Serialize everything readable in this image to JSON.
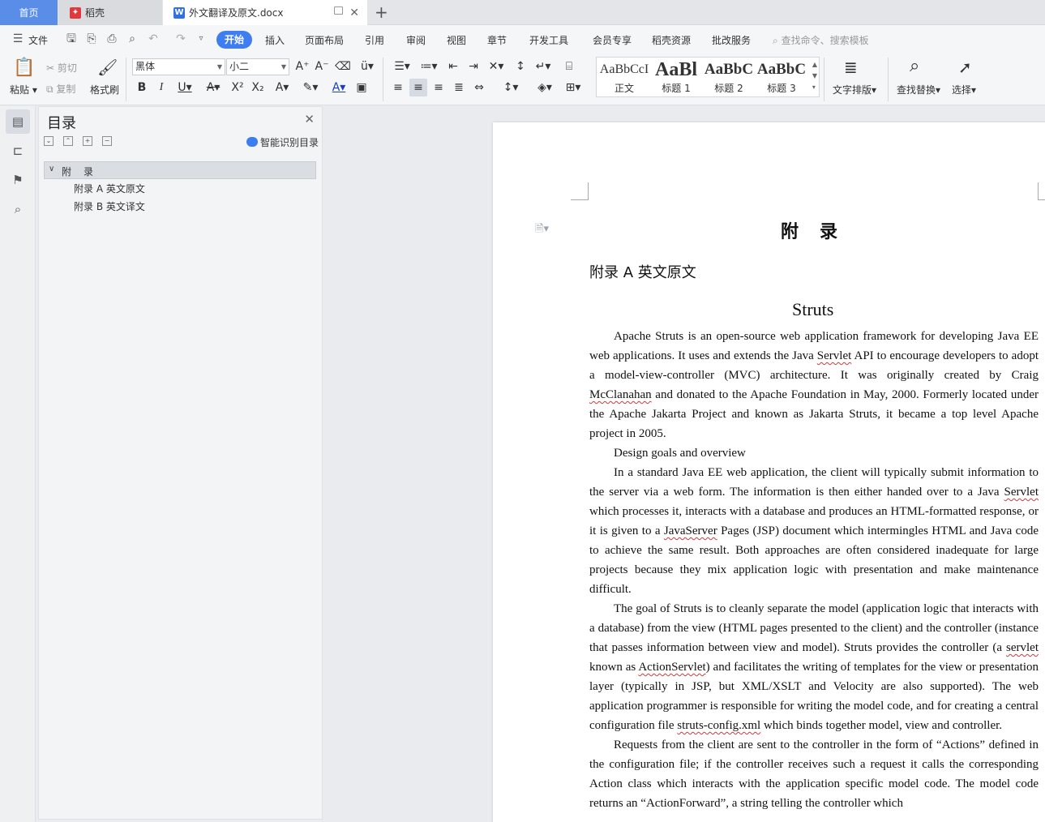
{
  "tabs": {
    "home": "首页",
    "daoke": "稻壳",
    "doc": "外文翻译及原文.docx",
    "new_tab_icon": "plus-icon"
  },
  "menu": {
    "file": "文件",
    "items": [
      "开始",
      "插入",
      "页面布局",
      "引用",
      "审阅",
      "视图",
      "章节",
      "开发工具",
      "会员专享",
      "稻壳资源",
      "批改服务"
    ],
    "search_placeholder": "查找命令、搜索模板"
  },
  "ribbon": {
    "paste": "粘贴",
    "cut": "剪切",
    "copy": "复制",
    "format_painter": "格式刷",
    "font_name": "黑体",
    "font_size": "小二",
    "styles": [
      {
        "preview": "AaBbCcI",
        "name": "正文"
      },
      {
        "preview": "AaBl",
        "name": "标题 1"
      },
      {
        "preview": "AaBbC",
        "name": "标题 2"
      },
      {
        "preview": "AaBbC",
        "name": "标题 3"
      }
    ],
    "text_layout": "文字排版",
    "find_replace": "查找替换",
    "select": "选择"
  },
  "nav": {
    "title": "目录",
    "smart_toc": "智能识别目录",
    "root": "附录",
    "items": [
      "附录 A  英文原文",
      "附录 B  英文译文"
    ]
  },
  "document": {
    "heading": "附录",
    "subheading": "附录 A  英文原文",
    "title": "Struts",
    "p1_a": "Apache Struts is an open-source web application framework for developing Java EE web applications. It uses and extends the Java ",
    "p1_w1": "Servlet",
    "p1_b": " API to encourage developers to adopt a model-view-controller (MVC) architecture. It was originally created by Craig ",
    "p1_w2": "McClanahan",
    "p1_c": " and donated to the Apache Foundation in May, 2000. Formerly located under the Apache Jakarta Project and known as Jakarta Struts, it became a top level Apache project in 2005.",
    "p2": "Design goals and overview",
    "p3_a": "In a standard Java EE web application, the client will typically submit information to the server via a web form. The information is then either handed over to a Java ",
    "p3_w1": "Servlet",
    "p3_b": " which processes it, interacts with a database and produces an HTML-formatted response, or it is given to a ",
    "p3_w2": "JavaServer",
    "p3_c": " Pages (JSP) document which intermingles HTML and Java code to achieve the same result. Both approaches are often considered inadequate for large projects because they mix application logic with presentation and make maintenance difficult.",
    "p4_a": "The goal of Struts is to cleanly separate the model (application logic that interacts with a database) from the view (HTML pages presented to the client) and the controller (instance that passes information between view and model). Struts provides the controller (a ",
    "p4_w1": "servlet",
    "p4_b": " known as ",
    "p4_w2": "ActionServlet",
    "p4_c": ") and facilitates the writing of templates for the view or presentation layer (typically in JSP, but XML/XSLT and Velocity are also supported). The web application programmer is responsible for writing the model code, and for creating a central configuration file ",
    "p4_w3": "struts-config.xml",
    "p4_d": " which binds together model, view and controller.",
    "p5": "Requests from the client are sent to the controller in the form of “Actions” defined in the configuration file; if the controller receives such a request it calls the corresponding Action class which interacts with the application specific model code. The model code returns an “ActionForward”, a string telling the controller which"
  },
  "colors": {
    "accent": "#3f7ef0",
    "home_tab": "#5a8de8",
    "spell_error": "#d03a3a"
  }
}
